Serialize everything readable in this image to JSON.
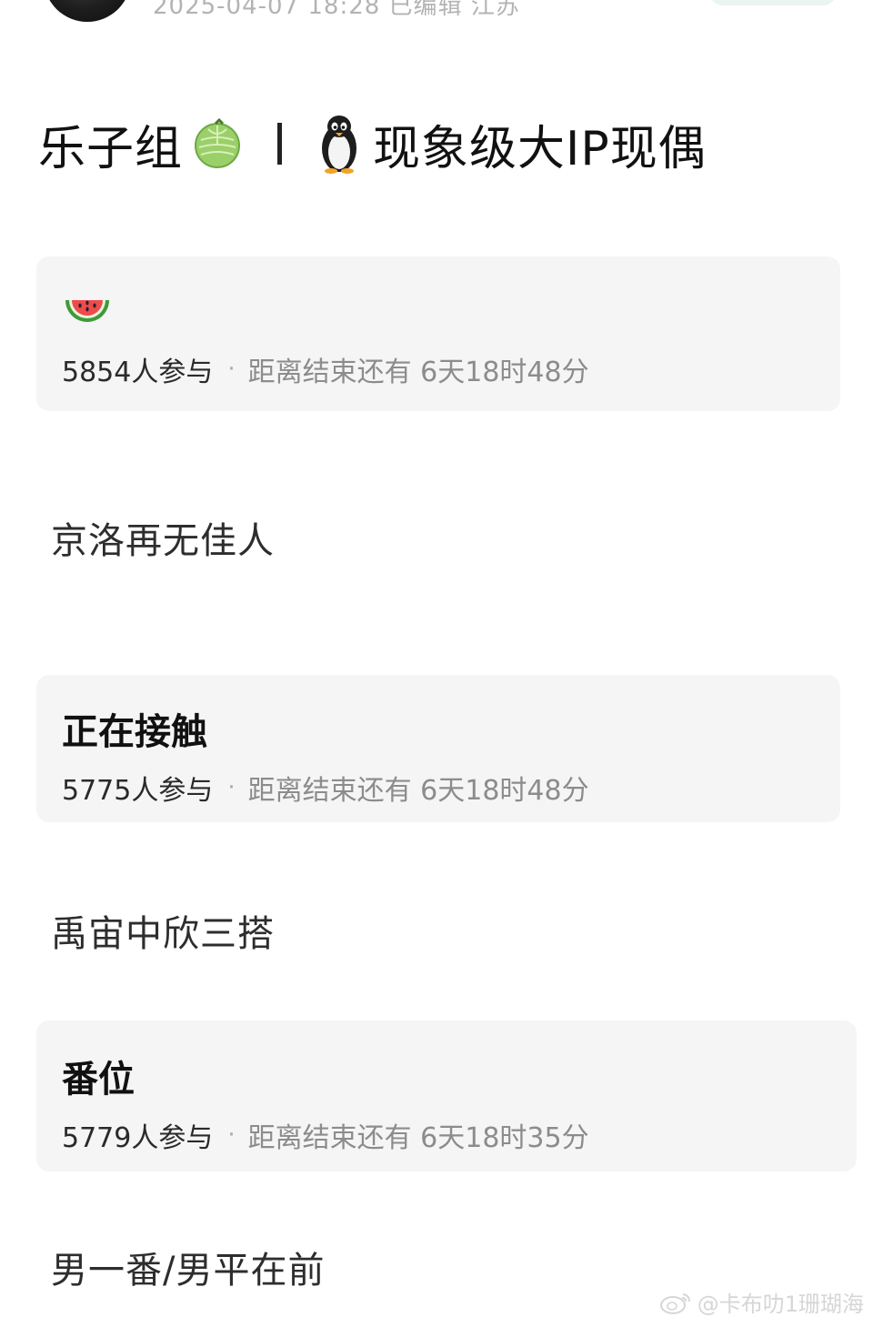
{
  "header": {
    "meta_text": "2025-04-07 18:28 已编辑 江苏"
  },
  "post": {
    "title_left": "乐子组",
    "title_left_icon": "melon-icon",
    "title_right_icon": "penguin-icon",
    "title_right": "现象级大IP现偶"
  },
  "polls": [
    {
      "title_icon": "watermelon-icon",
      "title": "",
      "participants": "5854人参与",
      "dot": "·",
      "remaining": "距离结束还有 6天18时48分",
      "answer": "京洛再无佳人"
    },
    {
      "title": "正在接触",
      "participants": "5775人参与",
      "dot": "·",
      "remaining": "距离结束还有 6天18时48分",
      "answer": "禹宙中欣三搭"
    },
    {
      "title": "番位",
      "participants": "5779人参与",
      "dot": "·",
      "remaining": "距离结束还有 6天18时35分",
      "answer": "男一番/男平在前"
    }
  ],
  "watermark": {
    "icon": "weibo-icon",
    "text": "@卡布叻1珊瑚海"
  },
  "colors": {
    "card_bg": "#f5f5f5",
    "muted_text": "#8c8c8c",
    "pill_green": "#e9f5ee"
  }
}
